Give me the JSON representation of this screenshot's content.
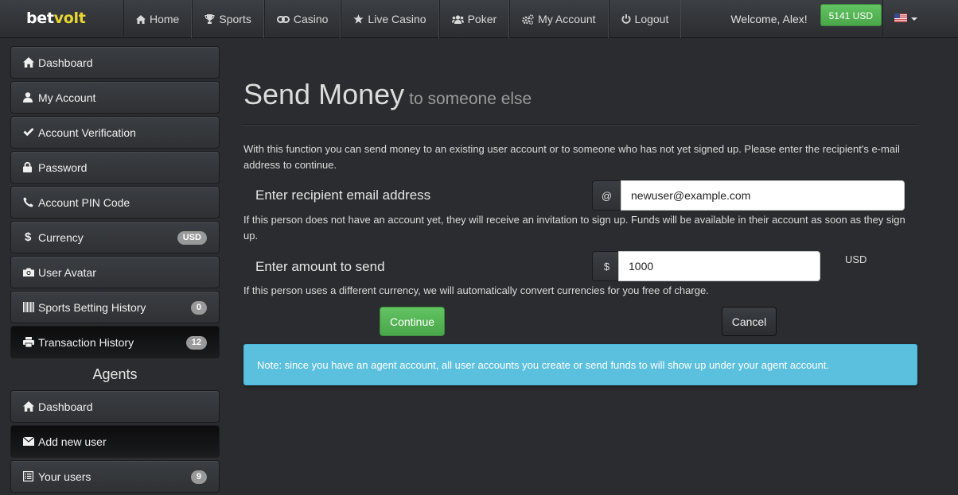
{
  "brand": {
    "part1": "bet",
    "part2": "volt"
  },
  "nav": {
    "items": [
      {
        "label": "Home",
        "icon": "home-icon"
      },
      {
        "label": "Sports",
        "icon": "trophy-icon"
      },
      {
        "label": "Casino",
        "icon": "link-icon"
      },
      {
        "label": "Live Casino",
        "icon": "star-icon"
      },
      {
        "label": "Poker",
        "icon": "users-icon"
      },
      {
        "label": "My Account",
        "icon": "cogs-icon"
      },
      {
        "label": "Logout",
        "icon": "power-icon"
      }
    ],
    "welcome": "Welcome, Alex!",
    "balance": "5141 USD",
    "language_flag": "us-flag-icon"
  },
  "sidebar": {
    "items": [
      {
        "label": "Dashboard",
        "icon": "home-icon"
      },
      {
        "label": "My Account",
        "icon": "user-icon"
      },
      {
        "label": "Account Verification",
        "icon": "check-icon"
      },
      {
        "label": "Password",
        "icon": "lock-icon"
      },
      {
        "label": "Account PIN Code",
        "icon": "phone-icon"
      },
      {
        "label": "Currency",
        "icon": "dollar-icon",
        "badge": "USD"
      },
      {
        "label": "User Avatar",
        "icon": "camera-icon"
      },
      {
        "label": "Sports Betting History",
        "icon": "barcode-icon",
        "badge": "0"
      },
      {
        "label": "Transaction History",
        "icon": "print-icon",
        "badge": "12"
      }
    ],
    "agents_heading": "Agents",
    "agent_items": [
      {
        "label": "Dashboard",
        "icon": "home-icon"
      },
      {
        "label": "Add new user",
        "icon": "envelope-icon"
      },
      {
        "label": "Your users",
        "icon": "list-icon",
        "badge": "9"
      }
    ]
  },
  "main": {
    "title": "Send Money",
    "subtitle": "to someone else",
    "intro": "With this function you can send money to an existing user account or to someone who has not yet signed up. Please enter the recipient's e-mail address to continue.",
    "email_label": "Enter recipient email address",
    "email_addon": "@",
    "email_value": "newuser@example.com",
    "email_help": "If this person does not have an account yet, they will receive an invitation to sign up. Funds will be available in their account as soon as they sign up.",
    "amount_label": "Enter amount to send",
    "amount_addon": "$",
    "amount_value": "1000",
    "amount_currency": "USD",
    "amount_help": "If this person uses a different currency, we will automatically convert currencies for you free of charge.",
    "continue_label": "Continue",
    "cancel_label": "Cancel",
    "note": "Note: since you have an agent account, all user accounts you create or send funds to will show up under your agent account."
  },
  "colors": {
    "background": "#2a2c2f",
    "success": "#5cb85c",
    "info": "#5bc0de",
    "brand_accent": "#e8d530"
  }
}
